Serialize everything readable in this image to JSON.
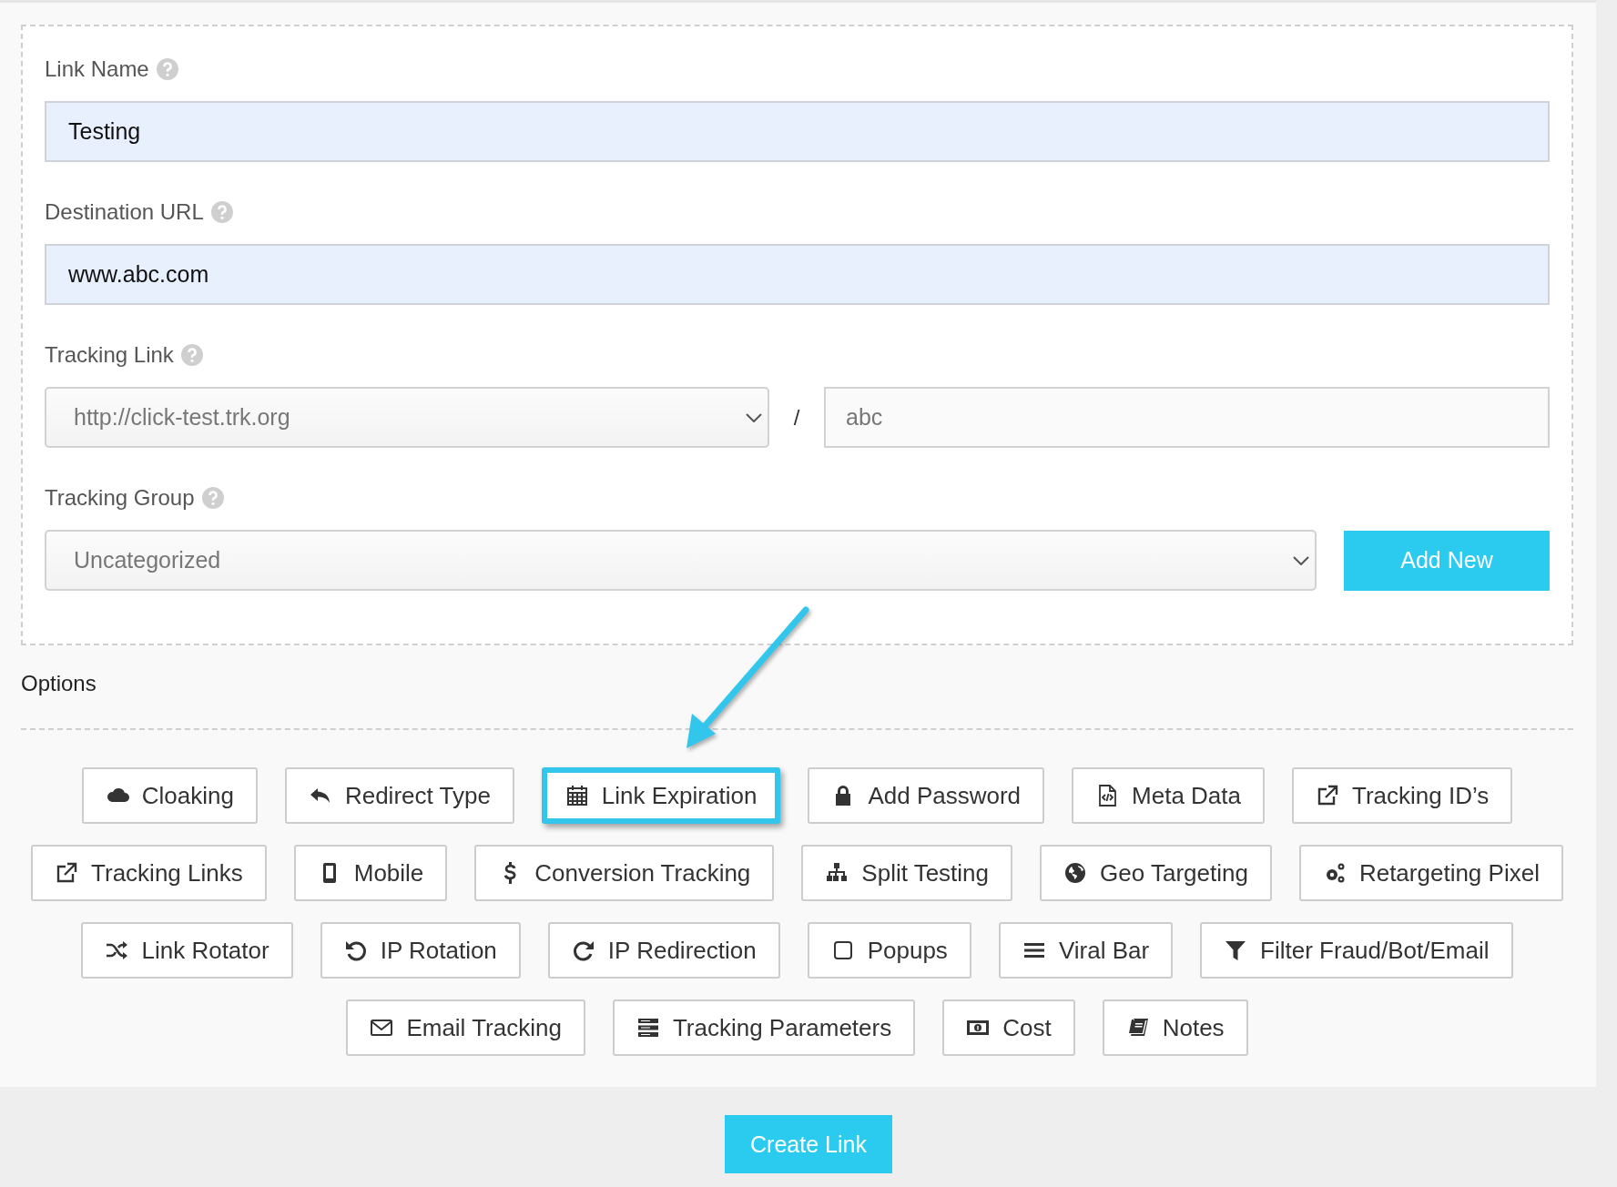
{
  "form": {
    "link_name": {
      "label": "Link Name",
      "value": "Testing"
    },
    "destination_url": {
      "label": "Destination URL",
      "value": "www.abc.com"
    },
    "tracking_link": {
      "label": "Tracking Link",
      "domain": "http://click-test.trk.org",
      "separator": "/",
      "slug": "abc"
    },
    "tracking_group": {
      "label": "Tracking Group",
      "value": "Uncategorized",
      "add_button": "Add New"
    }
  },
  "options": {
    "title": "Options",
    "rows": [
      {
        "buttons": [
          {
            "label": "Cloaking",
            "highlighted": false
          },
          {
            "label": "Redirect Type",
            "highlighted": false
          },
          {
            "label": "Link Expiration",
            "highlighted": true
          },
          {
            "label": "Add Password",
            "highlighted": false
          },
          {
            "label": "Meta Data",
            "highlighted": false
          },
          {
            "label": "Tracking ID’s",
            "highlighted": false
          }
        ]
      },
      {
        "buttons": [
          {
            "label": "Tracking Links",
            "highlighted": false
          },
          {
            "label": "Mobile",
            "highlighted": false
          },
          {
            "label": "Conversion Tracking",
            "highlighted": false
          },
          {
            "label": "Split Testing",
            "highlighted": false
          },
          {
            "label": "Geo Targeting",
            "highlighted": false
          },
          {
            "label": "Retargeting Pixel",
            "highlighted": false
          }
        ]
      },
      {
        "buttons": [
          {
            "label": "Link Rotator",
            "highlighted": false
          },
          {
            "label": "IP Rotation",
            "highlighted": false
          },
          {
            "label": "IP Redirection",
            "highlighted": false
          },
          {
            "label": "Popups",
            "highlighted": false
          },
          {
            "label": "Viral Bar",
            "highlighted": false
          },
          {
            "label": "Filter Fraud/Bot/Email",
            "highlighted": false
          }
        ]
      },
      {
        "buttons": [
          {
            "label": "Email Tracking",
            "highlighted": false
          },
          {
            "label": "Tracking Parameters",
            "highlighted": false
          },
          {
            "label": "Cost",
            "highlighted": false
          },
          {
            "label": "Notes",
            "highlighted": false
          }
        ]
      }
    ]
  },
  "submit_button": "Create Link"
}
